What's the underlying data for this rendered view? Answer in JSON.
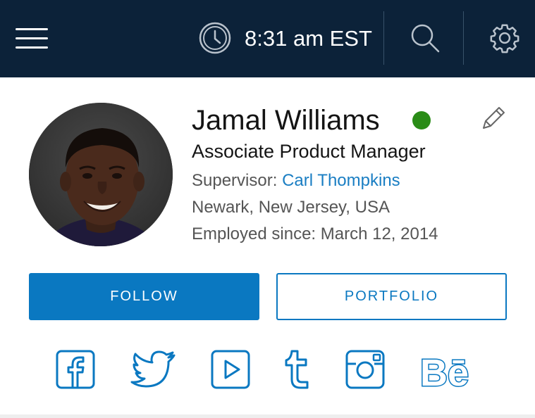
{
  "header": {
    "time": "8:31 am EST",
    "icons": [
      "menu-icon",
      "clock-icon",
      "search-icon",
      "settings-icon"
    ],
    "background_color": "#0c2239"
  },
  "profile": {
    "name": "Jamal Williams",
    "status": "online",
    "status_color": "#2a8c17",
    "title": "Associate Product Manager",
    "supervisor_label": "Supervisor: ",
    "supervisor_name": "Carl Thompkins",
    "location": "Newark, New Jersey, USA",
    "employed_since": "Employed since: March 12, 2014"
  },
  "actions": {
    "follow_label": "FOLLOW",
    "portfolio_label": "PORTFOLIO",
    "accent_color": "#0a78c1"
  },
  "social": {
    "icons": [
      "facebook-icon",
      "twitter-icon",
      "youtube-icon",
      "tumblr-icon",
      "instagram-icon",
      "behance-icon"
    ],
    "behance_text": "Bē"
  }
}
